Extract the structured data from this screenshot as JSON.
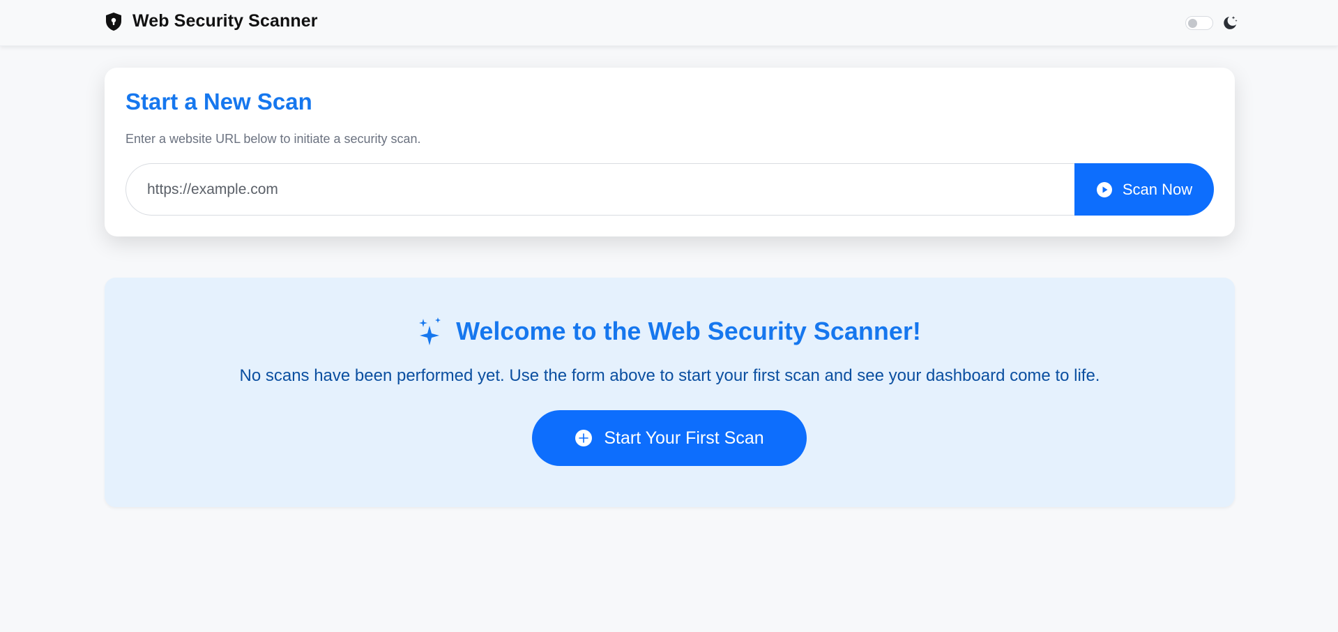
{
  "header": {
    "brand_title": "Web Security Scanner",
    "brand_icon": "shield-lock-icon",
    "theme_toggle_icon": "moon-stars-icon",
    "dark_mode_enabled": false
  },
  "scan_card": {
    "title": "Start a New Scan",
    "subtitle": "Enter a website URL below to initiate a security scan.",
    "url_input": {
      "value": "",
      "placeholder": "https://example.com"
    },
    "scan_button": {
      "label": "Scan Now",
      "icon": "play-circle-icon"
    }
  },
  "welcome": {
    "icon": "sparkles-icon",
    "title": "Welcome to the Web Security Scanner!",
    "text": "No scans have been performed yet. Use the form above to start your first scan and see your dashboard come to life.",
    "button": {
      "label": "Start Your First Scan",
      "icon": "plus-circle-icon"
    }
  },
  "colors": {
    "accent": "#0d6efd",
    "heading_blue": "#1677ee",
    "welcome_bg": "#e5f1fd",
    "welcome_text": "#0b4fa0",
    "page_bg": "#f7f8fa"
  }
}
